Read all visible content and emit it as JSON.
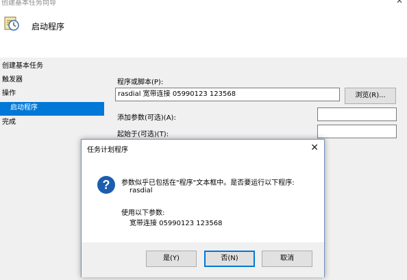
{
  "window": {
    "title": "创建基本任务向导"
  },
  "header": {
    "title": "启动程序",
    "icon": "task-clock-icon"
  },
  "nav": {
    "items": [
      {
        "label": "创建基本任务"
      },
      {
        "label": "触发器"
      },
      {
        "label": "操作"
      },
      {
        "label": "启动程序"
      },
      {
        "label": "完成"
      }
    ]
  },
  "form": {
    "program_label": "程序或脚本(P):",
    "program_value": "rasdial 宽带连接 05990123 123568",
    "browse_label": "浏览(R)...",
    "args_label": "添加参数(可选)(A):",
    "args_value": "",
    "start_label": "起始于(可选)(T):",
    "start_value": ""
  },
  "dialog": {
    "title": "任务计划程序",
    "icon": "question-icon",
    "message_line1": "参数似乎已包括在\"程序\"文本框中。是否要运行以下程序:",
    "program_name": "rasdial",
    "args_heading": "使用以下参数:",
    "args_value": "宽带连接 05990123 123568",
    "yes_label": "是(Y)",
    "no_label": "否(N)",
    "cancel_label": "取消"
  },
  "colors": {
    "accent": "#0078d7",
    "question_icon": "#1c5db0"
  }
}
